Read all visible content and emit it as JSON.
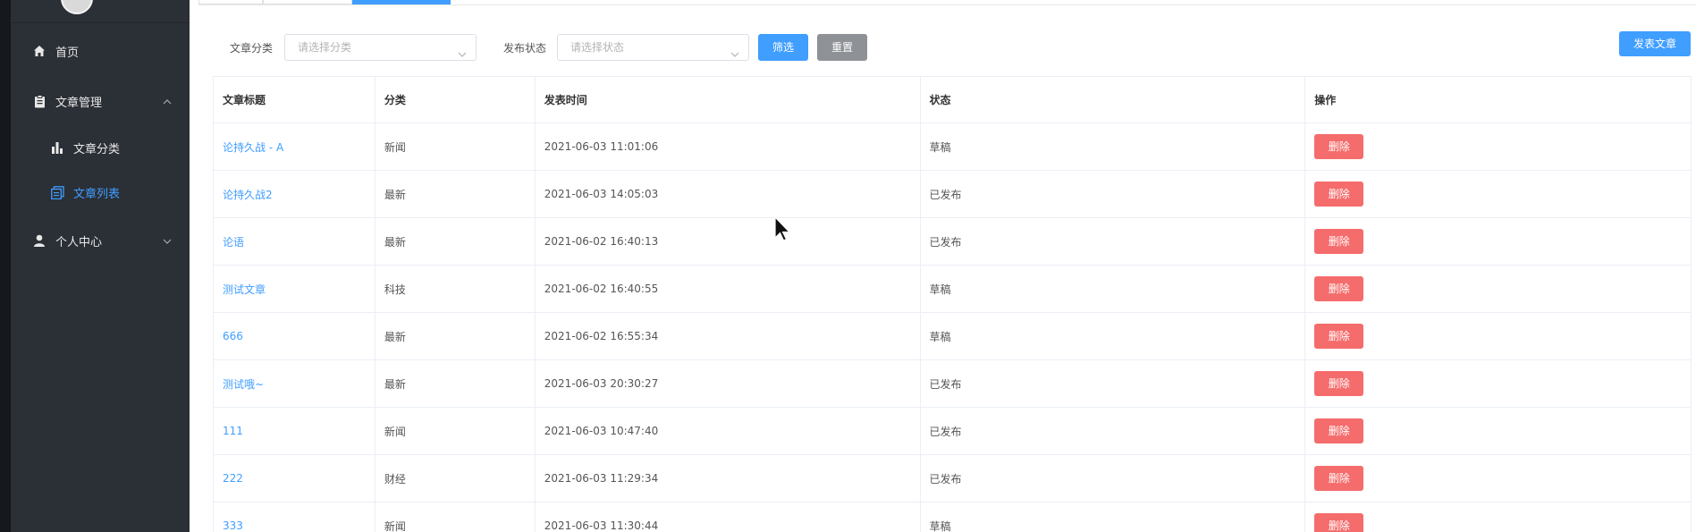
{
  "sidebar": {
    "items": [
      {
        "label": "首页",
        "icon": "home-icon"
      },
      {
        "label": "文章管理",
        "icon": "clipboard-icon",
        "expanded": true
      },
      {
        "label": "文章分类",
        "icon": "bar-chart-icon"
      },
      {
        "label": "文章列表",
        "icon": "list-icon",
        "active": true
      },
      {
        "label": "个人中心",
        "icon": "user-icon",
        "expanded": false
      }
    ]
  },
  "filters": {
    "category_label": "文章分类",
    "category_placeholder": "请选择分类",
    "status_label": "发布状态",
    "status_placeholder": "请选择状态",
    "filter_button": "筛选",
    "reset_button": "重置",
    "publish_button": "发表文章"
  },
  "table": {
    "headers": [
      "文章标题",
      "分类",
      "发表时间",
      "状态",
      "操作"
    ],
    "rows": [
      {
        "title": "论持久战 - A",
        "category": "新闻",
        "time": "2021-06-03 11:01:06",
        "status": "草稿",
        "action": "删除"
      },
      {
        "title": "论持久战2",
        "category": "最新",
        "time": "2021-06-03 14:05:03",
        "status": "已发布",
        "action": "删除"
      },
      {
        "title": "论语",
        "category": "最新",
        "time": "2021-06-02 16:40:13",
        "status": "已发布",
        "action": "删除"
      },
      {
        "title": "测试文章",
        "category": "科技",
        "time": "2021-06-02 16:40:55",
        "status": "草稿",
        "action": "删除"
      },
      {
        "title": "666",
        "category": "最新",
        "time": "2021-06-02 16:55:34",
        "status": "草稿",
        "action": "删除"
      },
      {
        "title": "测试哦~",
        "category": "最新",
        "time": "2021-06-03 20:30:27",
        "status": "已发布",
        "action": "删除"
      },
      {
        "title": "111",
        "category": "新闻",
        "time": "2021-06-03 10:47:40",
        "status": "已发布",
        "action": "删除"
      },
      {
        "title": "222",
        "category": "财经",
        "time": "2021-06-03 11:29:34",
        "status": "已发布",
        "action": "删除"
      },
      {
        "title": "333",
        "category": "新闻",
        "time": "2021-06-03 11:30:44",
        "status": "草稿",
        "action": "删除"
      }
    ]
  },
  "colors": {
    "primary": "#409eff",
    "danger": "#f56c6c",
    "sidebar_bg": "#2b2f36"
  }
}
